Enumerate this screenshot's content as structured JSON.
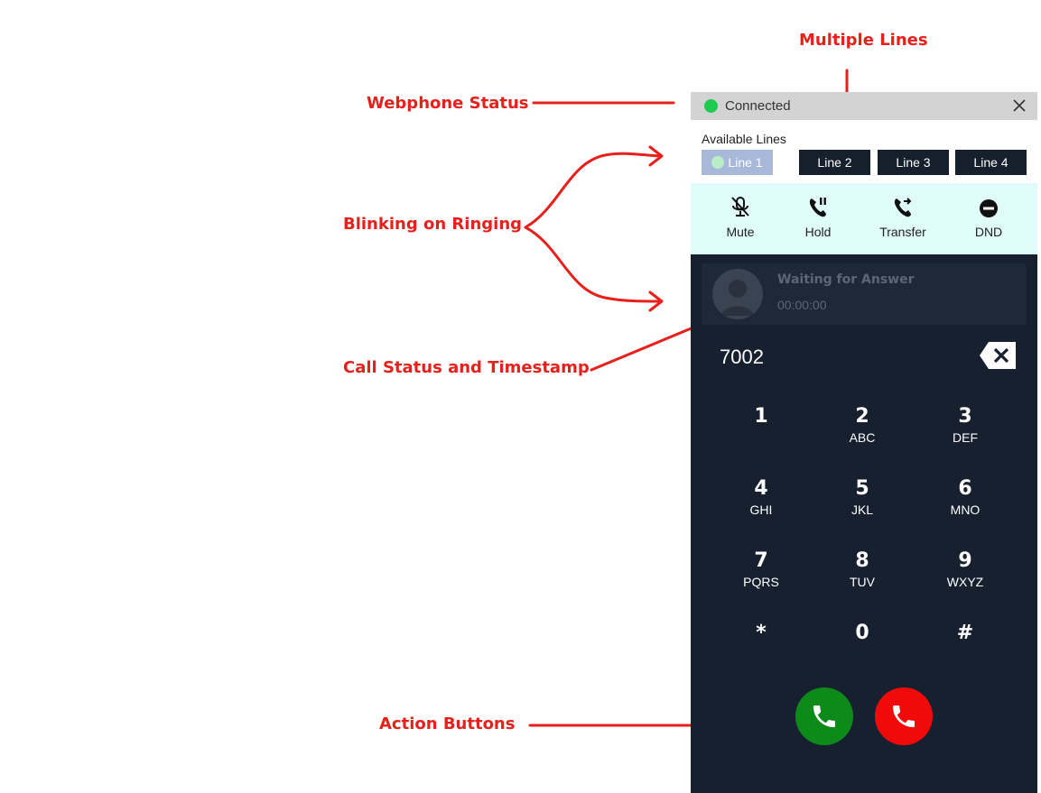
{
  "annotations": {
    "webphone_status": "Webphone Status",
    "multiple_lines": "Multiple Lines",
    "blinking_on_ringing": "Blinking on Ringing",
    "call_status_timestamp": "Call Status and Timestamp",
    "action_buttons": "Action Buttons"
  },
  "status": {
    "text": "Connected",
    "dot_color": "#1ecb4f"
  },
  "lines": {
    "label": "Available Lines",
    "items": [
      "Line 1",
      "Line 2",
      "Line 3",
      "Line 4"
    ],
    "active_index": 0
  },
  "controls": {
    "mute": "Mute",
    "hold": "Hold",
    "transfer": "Transfer",
    "dnd": "DND"
  },
  "call": {
    "status": "Waiting for Answer",
    "timer": "00:00:00"
  },
  "number": "7002",
  "keypad": [
    {
      "digit": "1",
      "letters": ""
    },
    {
      "digit": "2",
      "letters": "ABC"
    },
    {
      "digit": "3",
      "letters": "DEF"
    },
    {
      "digit": "4",
      "letters": "GHI"
    },
    {
      "digit": "5",
      "letters": "JKL"
    },
    {
      "digit": "6",
      "letters": "MNO"
    },
    {
      "digit": "7",
      "letters": "PQRS"
    },
    {
      "digit": "8",
      "letters": "TUV"
    },
    {
      "digit": "9",
      "letters": "WXYZ"
    },
    {
      "digit": "*",
      "letters": ""
    },
    {
      "digit": "0",
      "letters": ""
    },
    {
      "digit": "#",
      "letters": ""
    }
  ],
  "icons": {
    "close": "close-icon",
    "mute": "microphone-off-icon",
    "hold": "phone-pause-icon",
    "transfer": "phone-forward-icon",
    "dnd": "minus-circle-icon",
    "backspace": "backspace-icon",
    "call": "phone-icon",
    "hangup": "phone-hangup-icon"
  },
  "colors": {
    "annotation": "#e8201c",
    "dialer_bg": "#16202f",
    "controls_bg": "#dffcfb",
    "call_button": "#0e8a1a",
    "hangup_button": "#f10a0a"
  }
}
